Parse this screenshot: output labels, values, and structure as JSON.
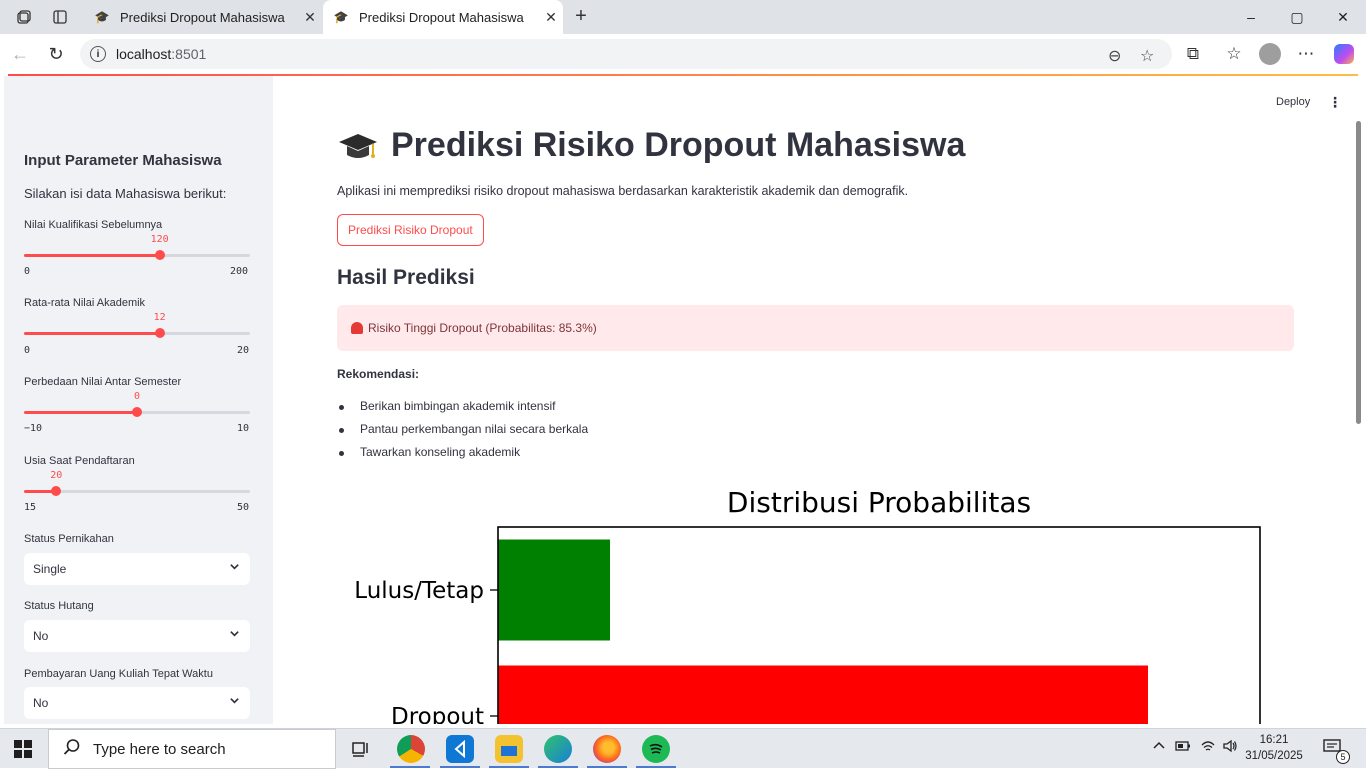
{
  "browser": {
    "tabs": [
      {
        "title": "Prediksi Dropout Mahasiswa",
        "active": false
      },
      {
        "title": "Prediksi Dropout Mahasiswa",
        "active": true
      }
    ],
    "url_host": "localhost",
    "url_port": ":8501",
    "icons": {
      "workspaces": "workspaces-icon",
      "tab_actions": "tab-actions-icon",
      "new_tab": "+",
      "minimize": "–",
      "maximize": "▢",
      "close": "✕",
      "back": "←",
      "refresh": "↻",
      "zoom": "⊖",
      "favorite": "☆",
      "extensions": "⧉",
      "favorites_bar": "☆",
      "menu": "⋯"
    }
  },
  "sidebar": {
    "header": "Input Parameter Mahasiswa",
    "subheader": "Silakan isi data Mahasiswa berikut:",
    "sliders": [
      {
        "label": "Nilai Kualifikasi Sebelumnya",
        "value": "120",
        "min": "0",
        "max": "200",
        "fraction": 0.6
      },
      {
        "label": "Rata-rata Nilai Akademik",
        "value": "12",
        "min": "0",
        "max": "20",
        "fraction": 0.6
      },
      {
        "label": "Perbedaan Nilai Antar Semester",
        "value": "0",
        "min": "−10",
        "max": "10",
        "fraction": 0.5
      },
      {
        "label": "Usia Saat Pendaftaran",
        "value": "20",
        "min": "15",
        "max": "50",
        "fraction": 0.143
      }
    ],
    "selects": [
      {
        "label": "Status Pernikahan",
        "value": "Single"
      },
      {
        "label": "Status Hutang",
        "value": "No"
      },
      {
        "label": "Pembayaran Uang Kuliah Tepat Waktu",
        "value": "No"
      }
    ]
  },
  "main": {
    "deploy": "Deploy",
    "kebab": "⋮",
    "title": "Prediksi Risiko Dropout Mahasiswa",
    "description": "Aplikasi ini memprediksi risiko dropout mahasiswa berdasarkan karakteristik akademik dan demografik.",
    "predict_button": "Prediksi Risiko Dropout",
    "result_heading": "Hasil Prediksi",
    "alert": "Risiko Tinggi Dropout (Probabilitas: 85.3%)",
    "recommendation_label": "Rekomendasi:",
    "recommendations": [
      "Berikan bimbingan akademik intensif",
      "Pantau perkembangan nilai secara berkala",
      "Tawarkan konseling akademik"
    ]
  },
  "chart_data": {
    "type": "bar",
    "orientation": "horizontal",
    "title": "Distribusi Probabilitas",
    "categories": [
      "Lulus/Tetap",
      "Dropout"
    ],
    "values": [
      0.147,
      0.853
    ],
    "colors": [
      "#008000",
      "#ff0000"
    ],
    "xlim": [
      0,
      1
    ],
    "grid": false
  },
  "taskbar": {
    "search_placeholder": "Type here to search",
    "time": "16:21",
    "date": "31/05/2025",
    "notification_count": "5",
    "apps": [
      "task-view",
      "chrome",
      "vscode",
      "file-explorer",
      "edge",
      "firefox",
      "spotify"
    ]
  }
}
